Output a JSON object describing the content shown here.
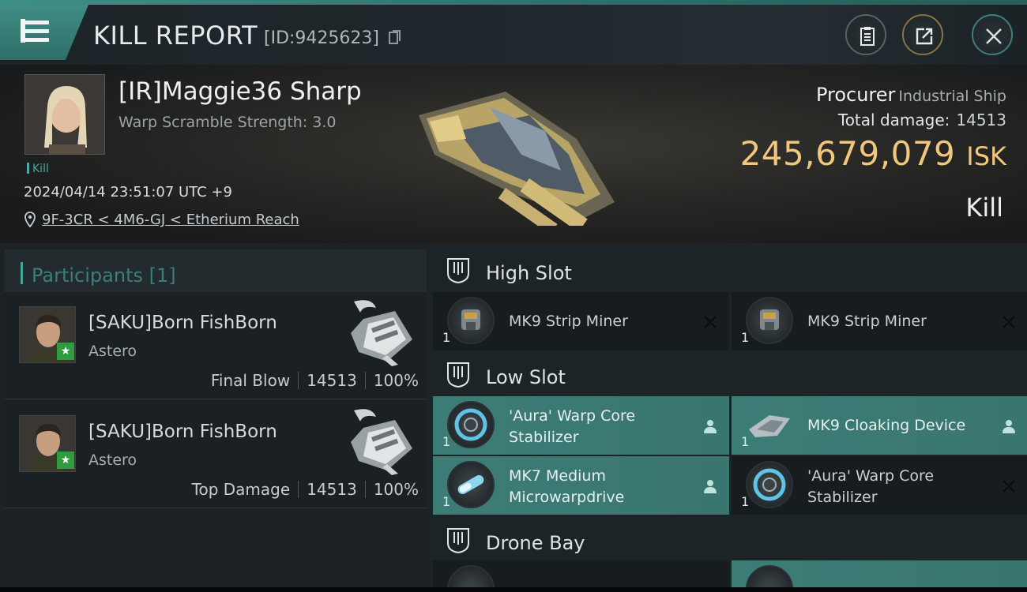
{
  "header": {
    "title": "KILL REPORT",
    "report_id": "[ID:9425623]",
    "icons": [
      "menu-icon",
      "copy-icon",
      "clipboard-icon",
      "share-icon",
      "close-icon"
    ]
  },
  "victim": {
    "name": "[IR]Maggie36 Sharp",
    "warp_scramble": "Warp Scramble Strength: 3.0",
    "tag": "Kill",
    "datetime": "2024/04/14 23:51:07 UTC +9",
    "location": "9F-3CR < 4M6-GJ < Etherium Reach"
  },
  "ship": {
    "name": "Procurer",
    "class": "Industrial Ship",
    "total_damage_label": "Total damage:",
    "total_damage": "14513",
    "isk_value": "245,679,079",
    "isk_unit": "ISK",
    "result": "Kill"
  },
  "participants": {
    "label": "Participants [1]",
    "items": [
      {
        "name": "[SAKU]Born FishBorn",
        "ship": "Astero",
        "role": "Final Blow",
        "damage": "14513",
        "percent": "100%"
      },
      {
        "name": "[SAKU]Born FishBorn",
        "ship": "Astero",
        "role": "Top Damage",
        "damage": "14513",
        "percent": "100%"
      }
    ]
  },
  "fitting": {
    "high_slot": {
      "label": "High Slot",
      "items": [
        {
          "name": "MK9 Strip Miner",
          "qty": "1",
          "status": "destroyed"
        },
        {
          "name": "MK9 Strip Miner",
          "qty": "1",
          "status": "destroyed"
        }
      ]
    },
    "low_slot": {
      "label": "Low Slot",
      "items": [
        {
          "name": "'Aura' Warp Core Stabilizer",
          "qty": "1",
          "status": "dropped"
        },
        {
          "name": "MK9 Cloaking Device",
          "qty": "1",
          "status": "dropped"
        },
        {
          "name": "MK7 Medium Microwarpdrive",
          "qty": "1",
          "status": "dropped"
        },
        {
          "name": "'Aura' Warp Core Stabilizer",
          "qty": "1",
          "status": "destroyed"
        }
      ]
    },
    "drone_bay": {
      "label": "Drone Bay"
    }
  },
  "colors": {
    "accent": "#3f8d84",
    "isk": "#f1c77b",
    "dropped_bg": "#3c7d76",
    "destroyed_bg": "#171c1f"
  }
}
